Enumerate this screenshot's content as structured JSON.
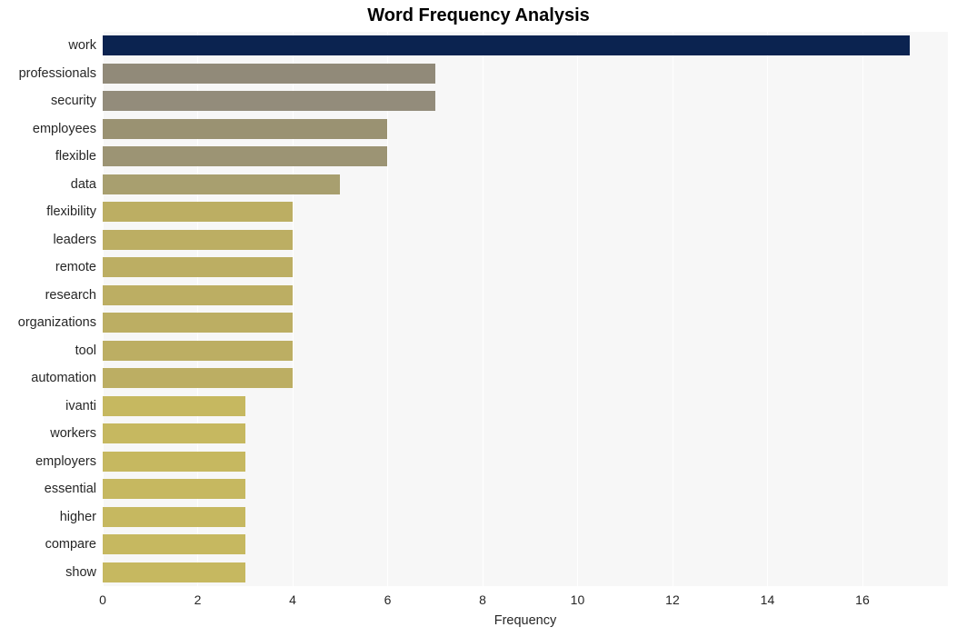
{
  "chart_data": {
    "type": "bar",
    "orientation": "horizontal",
    "title": "Word Frequency Analysis",
    "xlabel": "Frequency",
    "ylabel": "",
    "categories": [
      "work",
      "professionals",
      "security",
      "employees",
      "flexible",
      "data",
      "flexibility",
      "leaders",
      "remote",
      "research",
      "organizations",
      "tool",
      "automation",
      "ivanti",
      "workers",
      "employers",
      "essential",
      "higher",
      "compare",
      "show"
    ],
    "values": [
      17,
      7,
      7,
      6,
      6,
      5,
      4,
      4,
      4,
      4,
      4,
      4,
      4,
      3,
      3,
      3,
      3,
      3,
      3,
      3
    ],
    "bar_colors": [
      "#0b2350",
      "#918a79",
      "#938c7b",
      "#9a9272",
      "#9c9474",
      "#a89f6f",
      "#bcae63",
      "#bcae63",
      "#bcae63",
      "#bcae63",
      "#bcae63",
      "#bcae63",
      "#bcae63",
      "#c6b860",
      "#c6b860",
      "#c6b860",
      "#c6b860",
      "#c6b860",
      "#c6b860",
      "#c6b860"
    ],
    "xticks": [
      0,
      2,
      4,
      6,
      8,
      10,
      12,
      14,
      16
    ],
    "xlim": [
      0,
      17.8
    ],
    "grid": true,
    "grid_axis": "x",
    "plot_background": "#f7f7f7",
    "figure_background": "#ffffff",
    "gridline_color": "#ffffff",
    "text_color": "#262626"
  }
}
